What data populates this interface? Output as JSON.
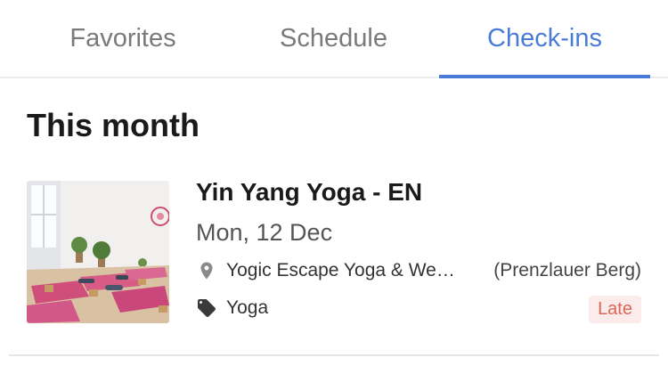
{
  "tabs": [
    {
      "label": "Favorites"
    },
    {
      "label": "Schedule"
    },
    {
      "label": "Check-ins",
      "active": true
    }
  ],
  "section": {
    "title": "This month"
  },
  "checkins": [
    {
      "class_name": "Yin Yang Yoga - EN",
      "date": "Mon, 12 Dec",
      "venue": "Yogic Escape Yoga & Wellness",
      "area": "(Prenzlauer Berg)",
      "category": "Yoga",
      "status": "Late",
      "icons": {
        "location": "location-pin-icon",
        "tag": "tag-icon"
      },
      "thumbnail": "yoga-studio-photo"
    }
  ],
  "colors": {
    "accent": "#4a7bd9",
    "late_text": "#d8675a",
    "late_bg": "#fbebea"
  }
}
